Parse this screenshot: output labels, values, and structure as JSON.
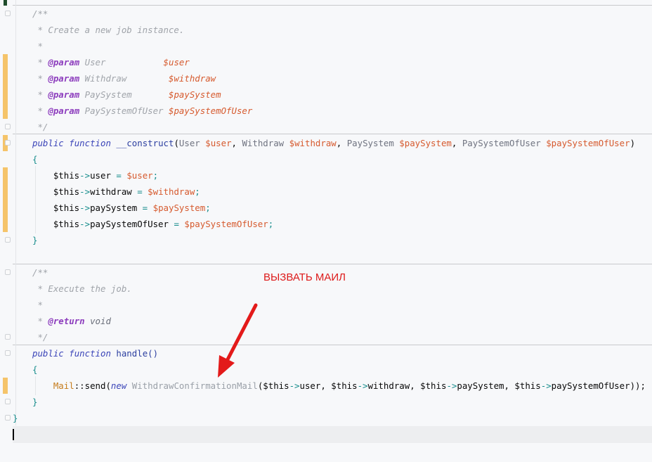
{
  "editor": {
    "doc1": {
      "open": "/**",
      "summary": "* Create a new job instance.",
      "blank": "*",
      "param_tag": "@param",
      "params": [
        {
          "type": "User",
          "name": "$user"
        },
        {
          "type": "Withdraw",
          "name": "$withdraw"
        },
        {
          "type": "PaySystem",
          "name": "$paySystem"
        },
        {
          "type": "PaySystemOfUser",
          "name": "$paySystemOfUser"
        }
      ],
      "close": "*/"
    },
    "construct": {
      "public": "public",
      "function": "function",
      "name": "__construct",
      "args": [
        {
          "type": "User",
          "name": "$user"
        },
        {
          "type": "Withdraw",
          "name": "$withdraw"
        },
        {
          "type": "PaySystem",
          "name": "$paySystem"
        },
        {
          "type": "PaySystemOfUser",
          "name": "$paySystemOfUser"
        }
      ],
      "open_brace": "{",
      "close_brace": "}",
      "body": [
        {
          "prop": "user",
          "value": "$user"
        },
        {
          "prop": "withdraw",
          "value": "$withdraw"
        },
        {
          "prop": "paySystem",
          "value": "$paySystem"
        },
        {
          "prop": "paySystemOfUser",
          "value": "$paySystemOfUser"
        }
      ]
    },
    "doc2": {
      "open": "/**",
      "summary": "* Execute the job.",
      "blank": "*",
      "return_tag": "@return",
      "return_type": "void",
      "close": "*/"
    },
    "handle": {
      "public": "public",
      "function": "function",
      "name": "handle()",
      "open_brace": "{",
      "close_brace": "}",
      "facade": "Mail",
      "method": "::send(",
      "new_kw": "new",
      "mail_class": "WithdrawConfirmationMail",
      "args": [
        "user",
        "withdraw",
        "paySystem",
        "paySystemOfUser"
      ],
      "this_var": "$this",
      "arrow": "->",
      "end": "));"
    },
    "class_close": "}"
  },
  "annotation": {
    "text": "ВЫЗВАТЬ МАИЛ",
    "color": "#dd1a1a"
  },
  "colors": {
    "background": "#f7f8fa",
    "vcs_modified": "#f5c46a",
    "variable": "#d65a2e",
    "keyword": "#3a44b8",
    "doc_tag": "#8c3cbd",
    "brace": "#178d8c"
  }
}
